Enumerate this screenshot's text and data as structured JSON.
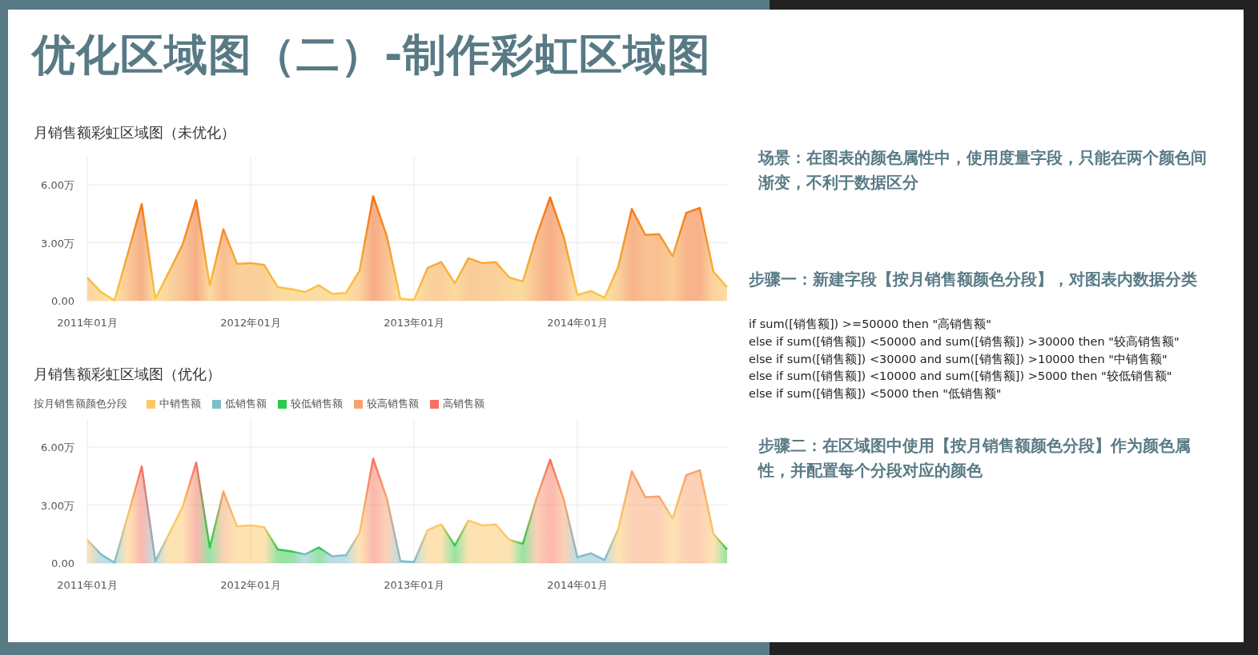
{
  "title": "优化区域图（二）-制作彩虹区域图",
  "charts": [
    {
      "title": "月销售额彩虹区域图（未优化）",
      "chart_data": {
        "type": "area",
        "grid": true,
        "categories": [
          "2011年01月",
          null,
          null,
          null,
          null,
          null,
          null,
          null,
          null,
          null,
          null,
          null,
          "2012年01月",
          null,
          null,
          null,
          null,
          null,
          null,
          null,
          null,
          null,
          null,
          null,
          "2013年01月",
          null,
          null,
          null,
          null,
          null,
          null,
          null,
          null,
          null,
          null,
          null,
          "2014年01月",
          null,
          null,
          null,
          null,
          null,
          null,
          null,
          null,
          null,
          null,
          null
        ],
        "series": [
          {
            "color": "#f56d14",
            "values": [
              1.2,
              0.45,
              0.02,
              2.5,
              5.0,
              0.1,
              1.5,
              2.9,
              5.2,
              0.8,
              3.7,
              1.9,
              1.95,
              1.85,
              0.7,
              0.6,
              0.45,
              0.8,
              0.35,
              0.4,
              1.55,
              5.4,
              3.35,
              0.1,
              0.05,
              1.7,
              2.0,
              0.9,
              2.2,
              1.95,
              2.0,
              1.2,
              1.0,
              3.35,
              5.35,
              3.3,
              0.3,
              0.5,
              0.15,
              1.75,
              4.75,
              3.4,
              3.45,
              2.3,
              4.55,
              4.8,
              1.5,
              0.7
            ]
          }
        ],
        "ylim": [
          0,
          7.45
        ],
        "yticks": [
          {
            "value": 0,
            "label": "0.00"
          },
          {
            "value": 3,
            "label": "3.00万"
          },
          {
            "value": 6,
            "label": "6.00万"
          }
        ]
      }
    },
    {
      "title": "月销售额彩虹区域图（优化）",
      "legend": {
        "title": "按月销售额颜色分段",
        "items": [
          {
            "label": "中销售额",
            "color": "#fdc765"
          },
          {
            "label": "低销售额",
            "color": "#7fbccc"
          },
          {
            "label": "较低销售额",
            "color": "#2ec84a"
          },
          {
            "label": "较高销售额",
            "color": "#f9a26c"
          },
          {
            "label": "高销售额",
            "color": "#f87060"
          }
        ]
      },
      "chart_data": {
        "type": "area",
        "grid": true,
        "categories": [
          "2011年01月",
          null,
          null,
          null,
          null,
          null,
          null,
          null,
          null,
          null,
          null,
          null,
          "2012年01月",
          null,
          null,
          null,
          null,
          null,
          null,
          null,
          null,
          null,
          null,
          null,
          "2013年01月",
          null,
          null,
          null,
          null,
          null,
          null,
          null,
          null,
          null,
          null,
          null,
          "2014年01月",
          null,
          null,
          null,
          null,
          null,
          null,
          null,
          null,
          null,
          null,
          null
        ],
        "series": [
          {
            "values": [
              1.2,
              0.45,
              0.02,
              2.5,
              5.0,
              0.1,
              1.5,
              2.9,
              5.2,
              0.8,
              3.7,
              1.9,
              1.95,
              1.85,
              0.7,
              0.6,
              0.45,
              0.8,
              0.35,
              0.4,
              1.55,
              5.4,
              3.35,
              0.1,
              0.05,
              1.7,
              2.0,
              0.9,
              2.2,
              1.95,
              2.0,
              1.2,
              1.0,
              3.35,
              5.35,
              3.3,
              0.3,
              0.5,
              0.15,
              1.75,
              4.75,
              3.4,
              3.45,
              2.3,
              4.55,
              4.8,
              1.5,
              0.7
            ]
          }
        ],
        "ylim": [
          0,
          7.45
        ],
        "yticks": [
          {
            "value": 0,
            "label": "0.00"
          },
          {
            "value": 3,
            "label": "3.00万"
          },
          {
            "value": 6,
            "label": "6.00万"
          }
        ]
      }
    }
  ],
  "notes": {
    "scenario": "场景：在图表的颜色属性中，使用度量字段，只能在两个颜色间渐变，不利于数据区分",
    "step1": "步骤一：新建字段**【按月销售额颜色分段】**，对图表内数据分类",
    "formula": [
      "if sum([销售额]) >=50000 then \"高销售额\"",
      "else if sum([销售额]) <50000 and sum([销售额]) >30000 then \"较高销售额\"",
      "else if sum([销售额]) <30000 and sum([销售额]) >10000 then \"中销售额\"",
      "else if sum([销售额]) <10000 and sum([销售额]) >5000 then \"较低销售额\"",
      "else if sum([销售额]) <5000 then \"低销售额\""
    ],
    "step2": "步骤二：在区域图中使用**【按月销售额颜色分段】**作为颜色属性，并配置每个分段对应的颜色"
  }
}
